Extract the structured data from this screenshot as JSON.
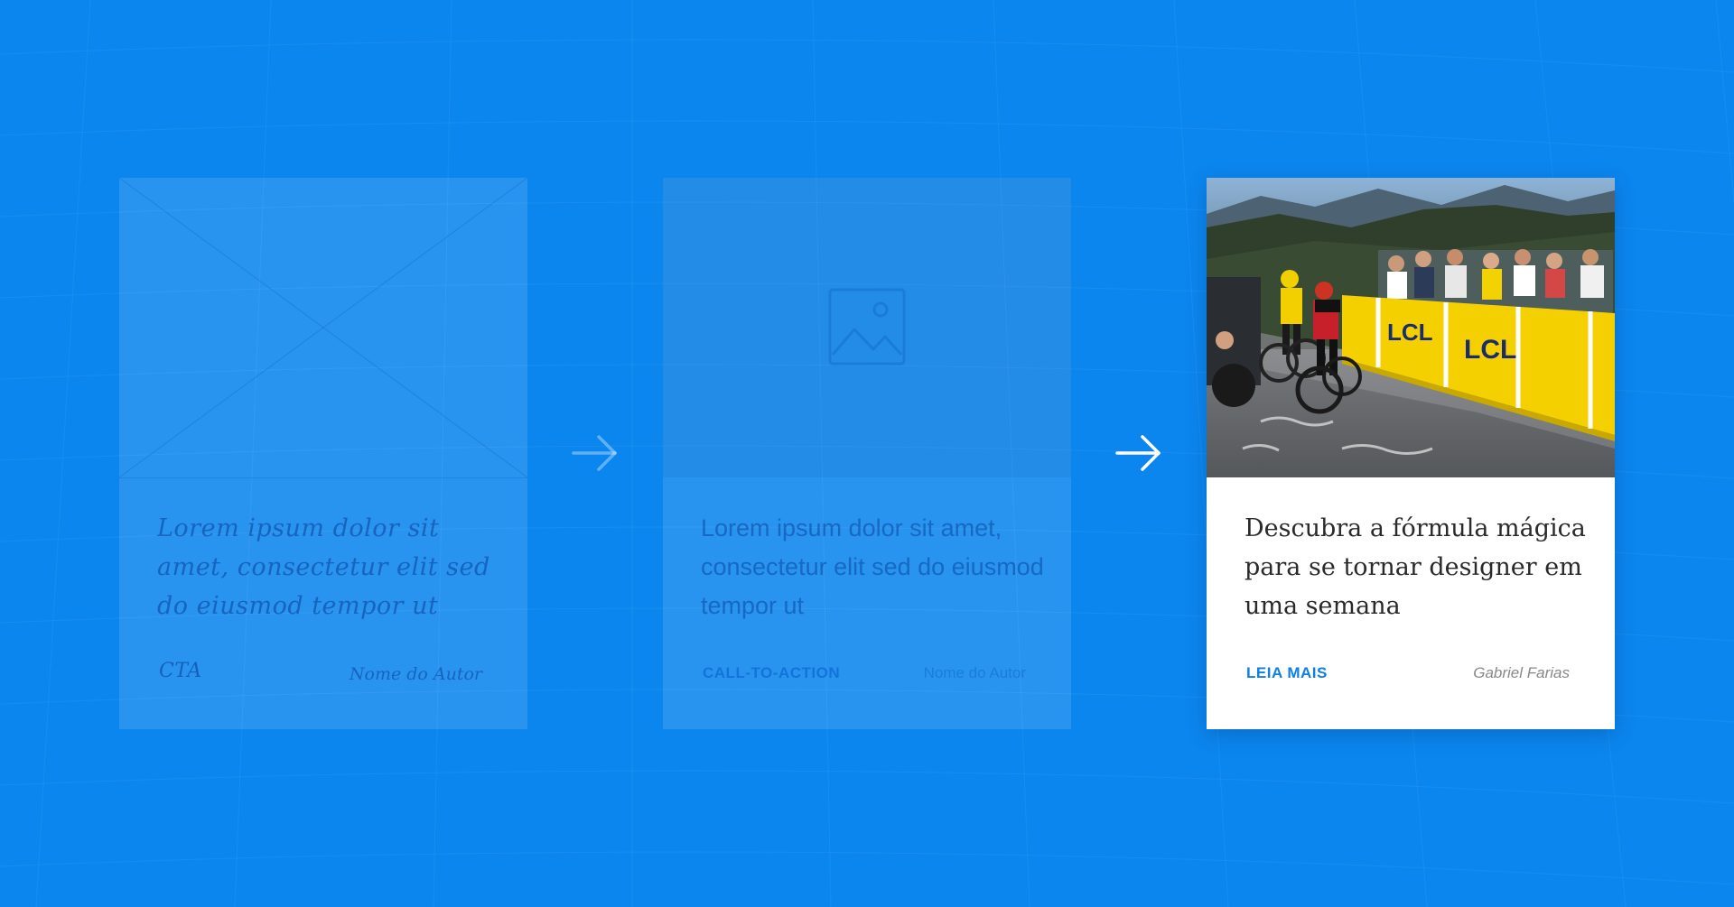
{
  "background_color": "#0b86ee",
  "cards": [
    {
      "stage": "sketch",
      "image_icon": "crossed-box-placeholder-icon",
      "title": "Lorem ipsum dolor sit amet, consectetur elit sed do eiusmod tempor ut",
      "cta": "CTA",
      "author": "Nome do Autor"
    },
    {
      "stage": "wireframe",
      "image_icon": "image-placeholder-icon",
      "title": "Lorem ipsum dolor sit amet, consectetur elit sed do eiusmod tempor ut",
      "cta": "CALL-TO-ACTION",
      "author": "Nome do Autor"
    },
    {
      "stage": "final",
      "image_icon": "cycling-race-photo",
      "title": "Descubra a fórmula mágica para se tornar designer em uma semana",
      "cta": "LEIA MAIS",
      "cta_color": "#0b7fe6",
      "author": "Gabriel Farias",
      "photo_banner_text": "LCL"
    }
  ],
  "arrows": [
    "arrow-right-icon",
    "arrow-right-icon"
  ]
}
